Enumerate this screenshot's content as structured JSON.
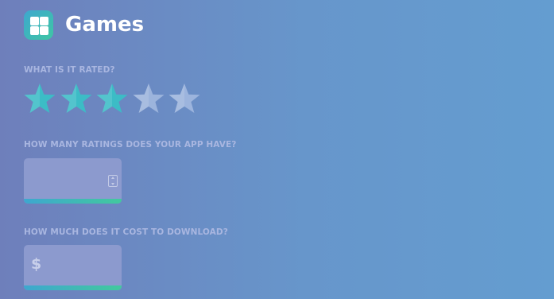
{
  "header": {
    "title": "Games",
    "icon": "grid-apps-icon",
    "icon_color": "#3fb8b8"
  },
  "rating": {
    "label": "WHAT IS IT RATED?",
    "value": 3,
    "max": 5,
    "filled_color": "#3cbcc6",
    "empty_color": "#a5bbe0"
  },
  "ratings_count": {
    "label": "HOW MANY RATINGS DOES YOUR APP HAVE?",
    "value": "",
    "placeholder": "",
    "icon": "number-stepper-icon"
  },
  "price": {
    "label": "HOW MUCH DOES IT COST TO DOWNLOAD?",
    "currency_symbol": "$",
    "value": "",
    "placeholder": ""
  }
}
